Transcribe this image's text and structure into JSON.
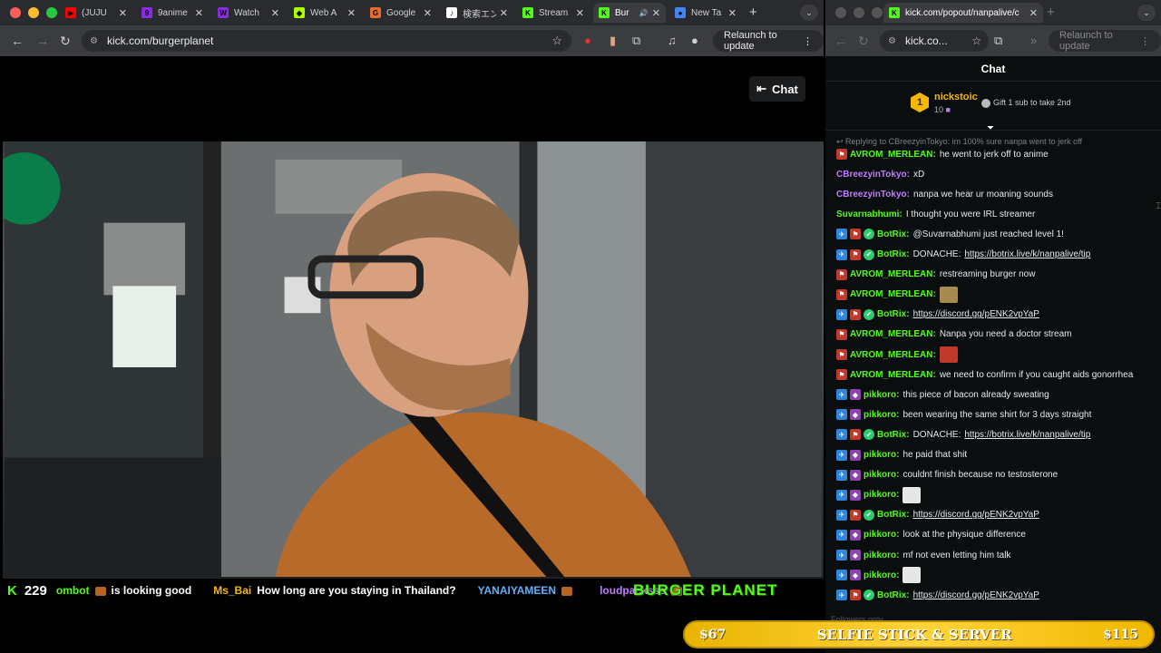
{
  "left_window": {
    "tabs": [
      {
        "label": "(JUJU",
        "color": "#ff0000",
        "glyph": "▶"
      },
      {
        "label": "9anime",
        "color": "#8a2be2",
        "glyph": "9"
      },
      {
        "label": "Watch",
        "color": "#8a2be2",
        "glyph": "W"
      },
      {
        "label": "Web A",
        "color": "#aaff00",
        "glyph": "◆"
      },
      {
        "label": "Google",
        "color": "#e86a33",
        "glyph": "G"
      },
      {
        "label": "検索エン",
        "color": "#ffffff",
        "glyph": "♪"
      },
      {
        "label": "Stream",
        "color": "#53fc18",
        "glyph": "K"
      },
      {
        "label": "Bur",
        "color": "#53fc18",
        "glyph": "K"
      },
      {
        "label": "New Ta",
        "color": "#4285f4",
        "glyph": "●"
      }
    ],
    "url": "kick.com/burgerplanet",
    "relaunch": "Relaunch to update"
  },
  "right_window": {
    "url": "kick.com/popout/nanpalive/c",
    "url_short": "kick.co...",
    "relaunch": "Relaunch to update"
  },
  "stream": {
    "chat_button": "Chat",
    "viewers": "229",
    "ticker": [
      {
        "user": "ombot",
        "user_color": "#53fc18",
        "text": "is looking good"
      },
      {
        "user": "Ms_Bai",
        "user_color": "#f5b700",
        "text": "How long are you staying in Thailand?"
      },
      {
        "user": "YANAIYAMEEN",
        "user_color": "#5fb0ff",
        "text": ""
      },
      {
        "user": "loudpacksss",
        "user_color": "#c07bff",
        "text": ""
      }
    ],
    "logo_text": "BURGER PLANET"
  },
  "chat": {
    "title": "Chat",
    "pinned_user": "nickstoic",
    "pinned_rank": "1",
    "pinned_count": "10",
    "pinned_gift": "Gift 1 sub to take 2nd",
    "reply_context": "Replying to CBreezyinTokyo: im 100% sure nanpa went to jerk off",
    "messages": [
      {
        "user": "AVROM_MERLEAN",
        "color": "#53fc18",
        "text": "he went to jerk off to anime",
        "badges": [
          "red"
        ]
      },
      {
        "user": "CBreezyinTokyo",
        "color": "#c07bff",
        "text": "xD",
        "badges": []
      },
      {
        "user": "CBreezyinTokyo",
        "color": "#c07bff",
        "text": "nanpa we hear ur moaning sounds",
        "badges": []
      },
      {
        "user": "Suvarnabhumi",
        "color": "#53fc18",
        "text": "I thought you were IRL streamer",
        "badges": []
      },
      {
        "user": "BotRix",
        "color": "#53fc18",
        "text": "@Suvarnabhumi just reached level 1!",
        "badges": [
          "blue",
          "red",
          "green"
        ]
      },
      {
        "user": "BotRix",
        "color": "#53fc18",
        "text": "DONACHE:",
        "link": "https://botrix.live/k/nanpalive/tip",
        "badges": [
          "blue",
          "red",
          "green"
        ]
      },
      {
        "user": "AVROM_MERLEAN",
        "color": "#53fc18",
        "text": "restreaming burger now",
        "badges": [
          "red"
        ]
      },
      {
        "user": "AVROM_MERLEAN",
        "color": "#53fc18",
        "text": "",
        "emote": "#a88a50",
        "badges": [
          "red"
        ]
      },
      {
        "user": "BotRix",
        "color": "#53fc18",
        "text": "",
        "link": "https://discord.gg/pENK2vpYaP",
        "badges": [
          "blue",
          "red",
          "green"
        ]
      },
      {
        "user": "AVROM_MERLEAN",
        "color": "#53fc18",
        "text": "Nanpa you need a doctor stream",
        "badges": [
          "red"
        ]
      },
      {
        "user": "AVROM_MERLEAN",
        "color": "#53fc18",
        "text": "",
        "emote": "#c0392b",
        "badges": [
          "red"
        ]
      },
      {
        "user": "AVROM_MERLEAN",
        "color": "#53fc18",
        "text": "we need to confirm if you caught aids gonorrhea",
        "badges": [
          "red"
        ]
      },
      {
        "user": "pikkoro",
        "color": "#53fc18",
        "text": "this piece of bacon already sweating",
        "badges": [
          "blue",
          "purple"
        ]
      },
      {
        "user": "pikkoro",
        "color": "#53fc18",
        "text": "been wearing the same shirt for 3 days straight",
        "badges": [
          "blue",
          "purple"
        ]
      },
      {
        "user": "BotRix",
        "color": "#53fc18",
        "text": "DONACHE:",
        "link": "https://botrix.live/k/nanpalive/tip",
        "badges": [
          "blue",
          "red",
          "green"
        ]
      },
      {
        "user": "pikkoro",
        "color": "#53fc18",
        "text": "he paid that shit",
        "badges": [
          "blue",
          "purple"
        ]
      },
      {
        "user": "pikkoro",
        "color": "#53fc18",
        "text": "couldnt finish because no testosterone",
        "badges": [
          "blue",
          "purple"
        ]
      },
      {
        "user": "pikkoro",
        "color": "#53fc18",
        "text": "",
        "emote": "#e6e6e6",
        "badges": [
          "blue",
          "purple"
        ]
      },
      {
        "user": "BotRix",
        "color": "#53fc18",
        "text": "",
        "link": "https://discord.gg/pENK2vpYaP",
        "badges": [
          "blue",
          "red",
          "green"
        ]
      },
      {
        "user": "pikkoro",
        "color": "#53fc18",
        "text": "look at the physique difference",
        "badges": [
          "blue",
          "purple"
        ]
      },
      {
        "user": "pikkoro",
        "color": "#53fc18",
        "text": "mf not even letting him talk",
        "badges": [
          "blue",
          "purple"
        ]
      },
      {
        "user": "pikkoro",
        "color": "#53fc18",
        "text": "",
        "emote": "#e6e6e6",
        "badges": [
          "blue",
          "purple"
        ]
      },
      {
        "user": "BotRix",
        "color": "#53fc18",
        "text": "",
        "link": "https://discord.gg/pENK2vpYaP",
        "badges": [
          "blue",
          "red",
          "green"
        ]
      }
    ],
    "footer_hint": "Followers only"
  },
  "goal": {
    "left": "$67",
    "title": "SELFIE STICK & SERVER",
    "right": "$115",
    "progress": 0.58
  }
}
